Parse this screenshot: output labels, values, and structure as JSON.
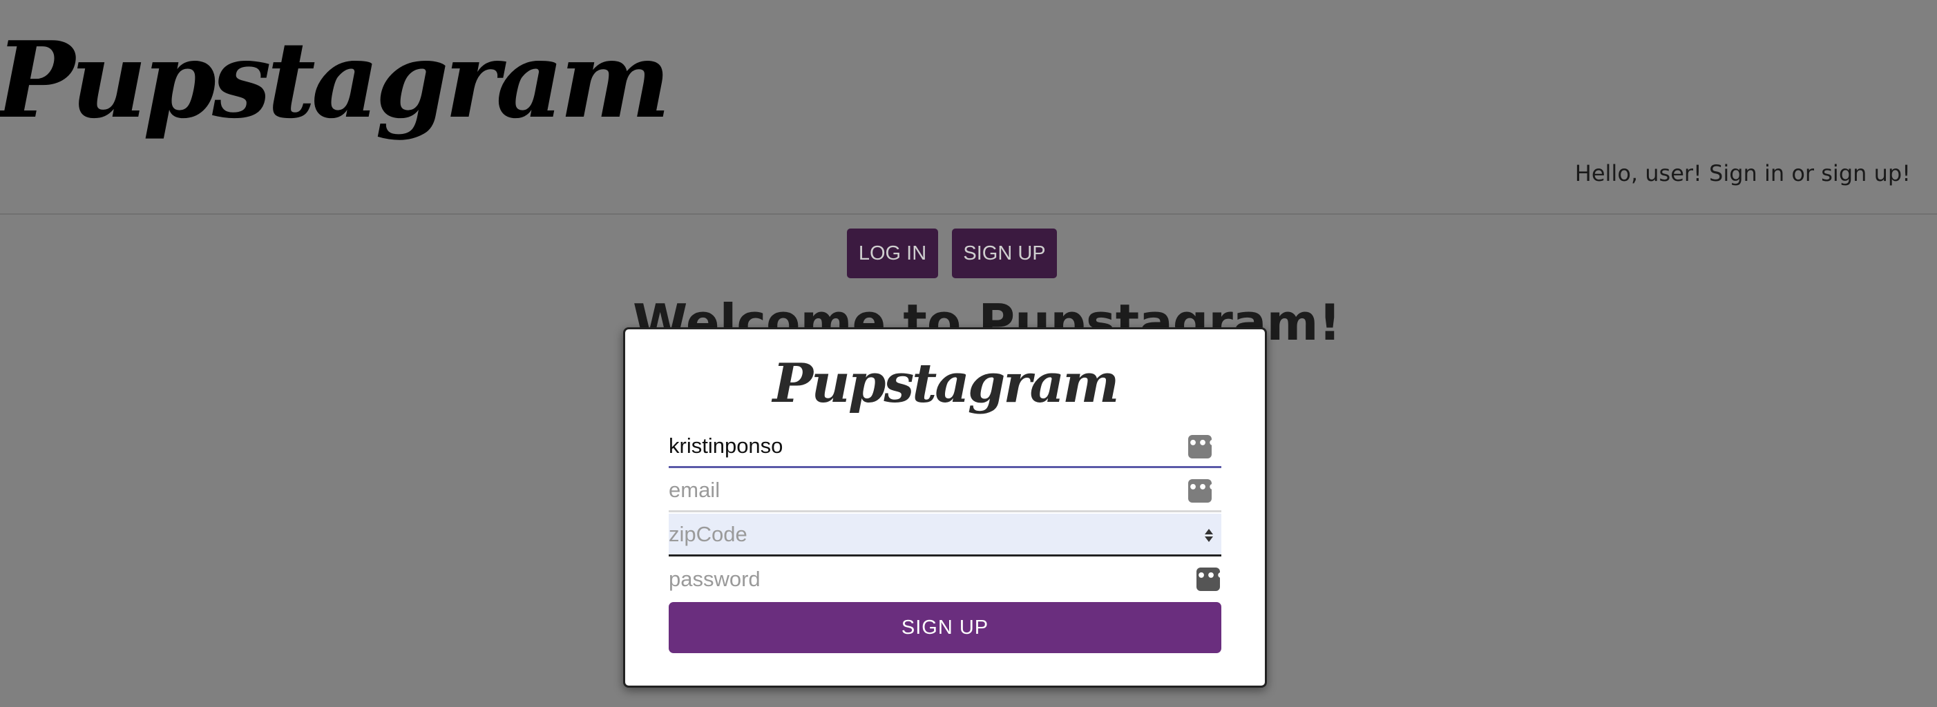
{
  "header": {
    "logo_text": "Pupstagram",
    "greeting": "Hello, user! Sign in or sign up!"
  },
  "nav": {
    "login_label": "LOG IN",
    "signup_label": "SIGN UP"
  },
  "main": {
    "heading": "Welcome to Pupstagram!"
  },
  "modal": {
    "logo_text": "Pupstagram",
    "fields": {
      "username": {
        "value": "kristinponso",
        "placeholder": ""
      },
      "email": {
        "value": "",
        "placeholder": "email"
      },
      "zip": {
        "value": "",
        "placeholder": "zipCode"
      },
      "password": {
        "value": "",
        "placeholder": "password"
      }
    },
    "submit_label": "SIGN UP"
  },
  "colors": {
    "overlay_gray": "#808080",
    "nav_button": "#3b1a40",
    "submit_button": "#6a2e7e",
    "focus_underline": "#5a59a8"
  },
  "icons": {
    "credential_helper": "more-dots-icon",
    "stepper": "stepper-arrows-icon"
  }
}
